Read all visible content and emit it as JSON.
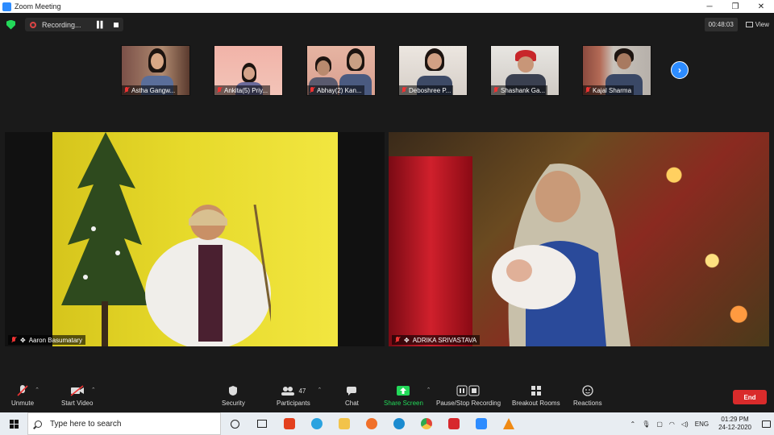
{
  "window": {
    "title": "Zoom Meeting"
  },
  "recording": {
    "label": "Recording..."
  },
  "timer": "00:48:03",
  "view_label": "View",
  "thumbnails": [
    {
      "name": "Astha Gangw..."
    },
    {
      "name": "Ankita(5) Priy..."
    },
    {
      "name": "Abhay(2) Kan..."
    },
    {
      "name": "Deboshree P..."
    },
    {
      "name": "Shashank Ga..."
    },
    {
      "name": "Kajal Sharma"
    }
  ],
  "tiles": [
    {
      "name": "Aaron Basumatary"
    },
    {
      "name": "ADRIKA SRIVASTAVA"
    }
  ],
  "controls": {
    "unmute": "Unmute",
    "start_video": "Start Video",
    "security": "Security",
    "participants": "Participants",
    "participants_count": "47",
    "chat": "Chat",
    "share_screen": "Share Screen",
    "recording": "Pause/Stop Recording",
    "breakout": "Breakout Rooms",
    "reactions": "Reactions",
    "end": "End"
  },
  "taskbar": {
    "search_placeholder": "Type here to search",
    "lang": "ENG",
    "time": "01:29 PM",
    "date": "24-12-2020"
  },
  "colors": {
    "accent": "#2d8cff",
    "share_green": "#23d959",
    "end_red": "#d92b2b",
    "background": "#1a1a1a"
  }
}
